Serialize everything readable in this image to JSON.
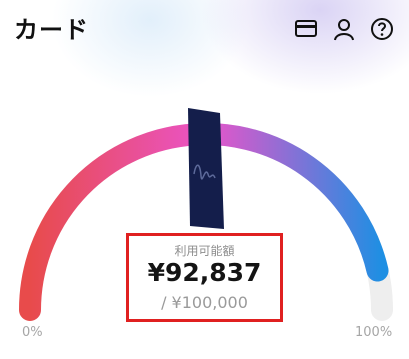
{
  "header": {
    "title": "カード",
    "icons": [
      "credit-card-icon",
      "user-icon",
      "help-icon"
    ]
  },
  "gauge": {
    "progress": 0.928,
    "min_label": "0%",
    "max_label": "100%",
    "colors": {
      "start": "#e84b4b",
      "mid": "#ea54c9",
      "end": "#1e8fe3",
      "track": "#eeeeee"
    }
  },
  "balance": {
    "label": "利用可能額",
    "amount": "¥92,837",
    "limit": "/ ¥100,000"
  },
  "card_image": {
    "color": "#141e4b"
  }
}
